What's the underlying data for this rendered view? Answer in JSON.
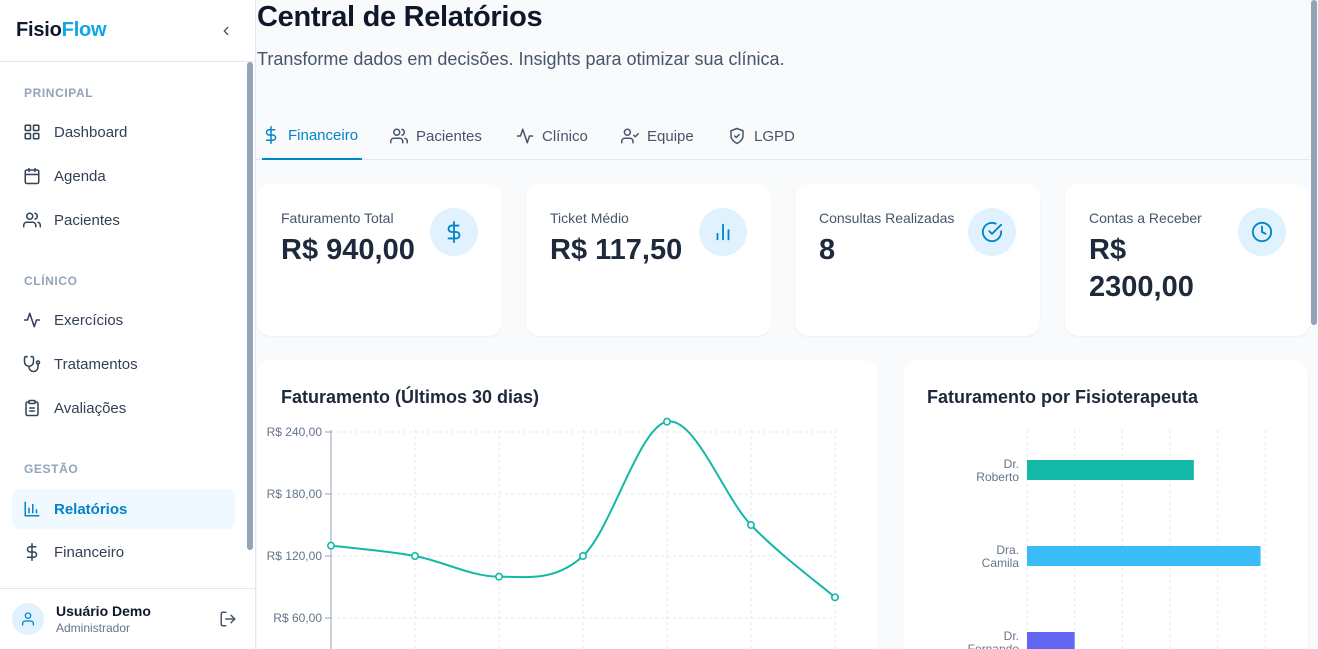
{
  "brand": {
    "part1": "Fisio",
    "part2": "Flow"
  },
  "sidebar": {
    "sections": [
      {
        "label": "PRINCIPAL"
      },
      {
        "label": "CLÍNICO"
      },
      {
        "label": "GESTÃO"
      }
    ],
    "items": [
      {
        "label": "Dashboard",
        "icon": "grid-icon"
      },
      {
        "label": "Agenda",
        "icon": "calendar-icon"
      },
      {
        "label": "Pacientes",
        "icon": "users-icon"
      },
      {
        "label": "Exercícios",
        "icon": "activity-icon"
      },
      {
        "label": "Tratamentos",
        "icon": "stethoscope-icon"
      },
      {
        "label": "Avaliações",
        "icon": "clipboard-icon"
      },
      {
        "label": "Relatórios",
        "icon": "bar-chart-icon",
        "active": true
      },
      {
        "label": "Financeiro",
        "icon": "dollar-icon"
      }
    ]
  },
  "user": {
    "name": "Usuário Demo",
    "role": "Administrador"
  },
  "page": {
    "title": "Central de Relatórios",
    "subtitle": "Transforme dados em decisões. Insights para otimizar sua clínica."
  },
  "tabs": [
    {
      "label": "Financeiro",
      "icon": "dollar-icon",
      "active": true
    },
    {
      "label": "Pacientes",
      "icon": "users-icon"
    },
    {
      "label": "Clínico",
      "icon": "activity-icon"
    },
    {
      "label": "Equipe",
      "icon": "user-check-icon"
    },
    {
      "label": "LGPD",
      "icon": "shield-check-icon"
    }
  ],
  "kpis": [
    {
      "label": "Faturamento Total",
      "value": "R$ 940,00",
      "icon": "dollar-icon"
    },
    {
      "label": "Ticket Médio",
      "value": "R$ 117,50",
      "icon": "bar-chart-icon"
    },
    {
      "label": "Consultas Realizadas",
      "value": "8",
      "icon": "check-circle-icon"
    },
    {
      "label": "Contas a Receber",
      "value": "R$ 2300,00",
      "icon": "clock-icon"
    }
  ],
  "colors": {
    "accent": "#0284c7",
    "line": "#14b8a6",
    "bar1": "#14b8a6",
    "bar2": "#38bdf8",
    "bar3": "#6366f1"
  },
  "chart_data": [
    {
      "type": "line",
      "title": "Faturamento (Últimos 30 dias)",
      "y_ticks": [
        "R$ 60,00",
        "R$ 120,00",
        "R$ 180,00",
        "R$ 240,00"
      ],
      "y_tick_values": [
        60,
        120,
        180,
        240
      ],
      "ylim": [
        40,
        250
      ],
      "values": [
        130,
        120,
        100,
        120,
        250,
        150,
        80
      ],
      "grid": true
    },
    {
      "type": "bar",
      "orientation": "horizontal",
      "title": "Faturamento por Fisioterapeuta",
      "categories": [
        "Dr. Roberto",
        "Dra. Camila",
        "Dr. Fernando"
      ],
      "values": [
        280,
        392,
        80
      ],
      "xlim": [
        0,
        480
      ],
      "grid": true
    }
  ]
}
